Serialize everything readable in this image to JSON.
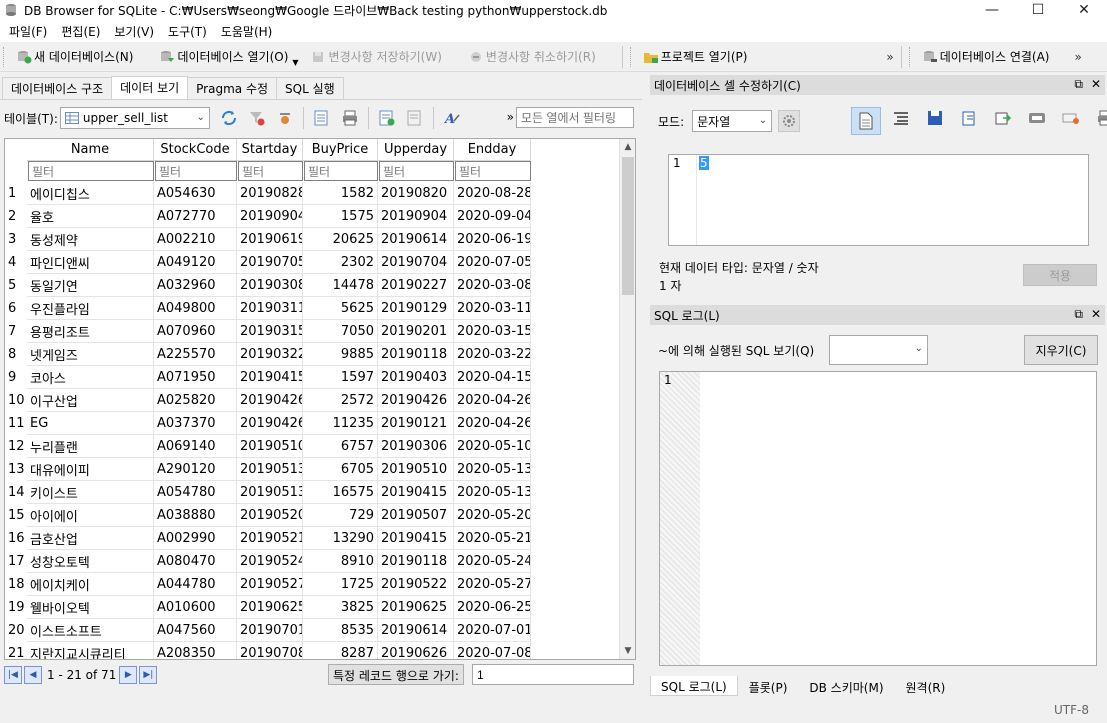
{
  "window": {
    "title": "DB Browser for SQLite - C:₩Users₩seong₩Google 드라이브₩Back testing python₩upperstock.db",
    "minimize": "—",
    "maximize": "☐",
    "close": "✕"
  },
  "menu": [
    "파일(F)",
    "편집(E)",
    "보기(V)",
    "도구(T)",
    "도움말(H)"
  ],
  "toolbar": {
    "new_db": "새 데이터베이스(N)",
    "open_db": "데이터베이스 열기(O)",
    "write_changes": "변경사항 저장하기(W)",
    "revert_changes": "변경사항 취소하기(R)",
    "open_project": "프로젝트 열기(P)",
    "attach_db": "데이터베이스 연결(A)",
    "more": "»"
  },
  "main_tabs": [
    "데이터베이스 구조",
    "데이터 보기",
    "Pragma 수정",
    "SQL 실행"
  ],
  "browse": {
    "table_label": "테이블(T):",
    "table_selected": "upper_sell_list",
    "filter_placeholder": "모든 열에서 필터링",
    "more": "»",
    "columns": [
      "Name",
      "StockCode",
      "Startday",
      "BuyPrice",
      "Upperday",
      "Endday"
    ],
    "filter_text": "필터",
    "rows": [
      [
        "1",
        "에이디칩스",
        "A054630",
        "20190828",
        "1582",
        "20190820",
        "2020-08-28"
      ],
      [
        "2",
        "율호",
        "A072770",
        "20190904",
        "1575",
        "20190904",
        "2020-09-04"
      ],
      [
        "3",
        "동성제약",
        "A002210",
        "20190619",
        "20625",
        "20190614",
        "2020-06-19"
      ],
      [
        "4",
        "파인디앤씨",
        "A049120",
        "20190705",
        "2302",
        "20190704",
        "2020-07-05"
      ],
      [
        "5",
        "동일기연",
        "A032960",
        "20190308",
        "14478",
        "20190227",
        "2020-03-08"
      ],
      [
        "6",
        "우진플라임",
        "A049800",
        "20190311",
        "5625",
        "20190129",
        "2020-03-11"
      ],
      [
        "7",
        "용평리조트",
        "A070960",
        "20190315",
        "7050",
        "20190201",
        "2020-03-15"
      ],
      [
        "8",
        "넷게임즈",
        "A225570",
        "20190322",
        "9885",
        "20190118",
        "2020-03-22"
      ],
      [
        "9",
        "코아스",
        "A071950",
        "20190415",
        "1597",
        "20190403",
        "2020-04-15"
      ],
      [
        "10",
        "이구산업",
        "A025820",
        "20190426",
        "2572",
        "20190426",
        "2020-04-26"
      ],
      [
        "11",
        "EG",
        "A037370",
        "20190426",
        "11235",
        "20190121",
        "2020-04-26"
      ],
      [
        "12",
        "누리플랜",
        "A069140",
        "20190510",
        "6757",
        "20190306",
        "2020-05-10"
      ],
      [
        "13",
        "대유에이피",
        "A290120",
        "20190513",
        "6705",
        "20190510",
        "2020-05-13"
      ],
      [
        "14",
        "키이스트",
        "A054780",
        "20190513",
        "16575",
        "20190415",
        "2020-05-13"
      ],
      [
        "15",
        "아이에이",
        "A038880",
        "20190520",
        "729",
        "20190507",
        "2020-05-20"
      ],
      [
        "16",
        "금호산업",
        "A002990",
        "20190521",
        "13290",
        "20190415",
        "2020-05-21"
      ],
      [
        "17",
        "성창오토텍",
        "A080470",
        "20190524",
        "8910",
        "20190118",
        "2020-05-24"
      ],
      [
        "18",
        "에이치케이",
        "A044780",
        "20190527",
        "1725",
        "20190522",
        "2020-05-27"
      ],
      [
        "19",
        "웰바이오텍",
        "A010600",
        "20190625",
        "3825",
        "20190625",
        "2020-06-25"
      ],
      [
        "20",
        "이스트소프트",
        "A047560",
        "20190701",
        "8535",
        "20190614",
        "2020-07-01"
      ],
      [
        "21",
        "지란지교시큐리티",
        "A208350",
        "20190708",
        "8287",
        "20190626",
        "2020-07-08"
      ]
    ],
    "nav_text": "1 - 21 of 71",
    "goto_label": "특정 레코드 행으로 가기:",
    "goto_value": "1"
  },
  "cell_editor": {
    "title": "데이터베이스 셀 수정하기(C)",
    "mode_label": "모드:",
    "mode_value": "문자열",
    "line_number": "1",
    "content": "5",
    "type_text": "현재 데이터 타입: 문자열 / 숫자",
    "size_text": "1 자",
    "apply": "적용"
  },
  "sql_log": {
    "title": "SQL 로그(L)",
    "shown_by_label": "~에 의해 실행된 SQL 보기(Q)",
    "clear": "지우기(C)",
    "line_number": "1"
  },
  "bottom_tabs": [
    "SQL 로그(L)",
    "플롯(P)",
    "DB 스키마(M)",
    "원격(R)"
  ],
  "status": {
    "encoding": "UTF-8"
  },
  "dock_controls": {
    "float": "⧉",
    "close": "✕"
  },
  "colors": {
    "accent_blue": "#3399ff",
    "nav_blue": "#2a5cb8"
  }
}
